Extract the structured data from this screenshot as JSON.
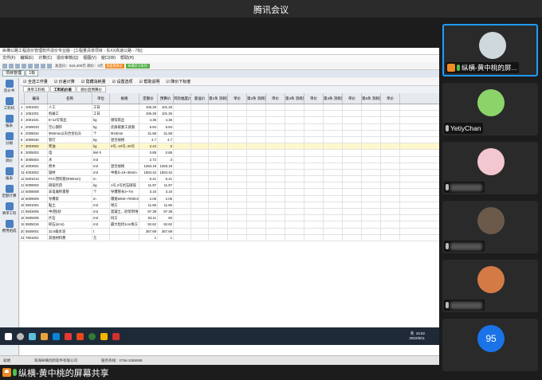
{
  "meeting": {
    "title": "腾讯会议",
    "share_label": "纵横-黄中桃的屏幕共享"
  },
  "app": {
    "title": "纵横公路工程造价管理软件造价专业版 - [工程量清单项目 - 东XX高速公路 - 7标]",
    "menus": [
      "文件(F)",
      "编辑(E)",
      "计算(C)",
      "造价审核(Q)",
      "视图(V)",
      "窗口(W)",
      "帮助(H)"
    ],
    "toolbar_info": "总造价：519,400元  调价：0元",
    "orange_btn": "我要提建议",
    "green_btn": "纵横学习系列",
    "module_tab": "项目管理",
    "doc_tab": "1标",
    "filters": [
      "全选工作量",
      "价差计算",
      "隐藏消耗量",
      "设置选项",
      "帮助说明",
      "降价下标度"
    ],
    "subtabs": [
      "清单工料机",
      "工料机价差",
      "调价后预算价"
    ],
    "active_subtab": 1,
    "left_nav": [
      "造价书",
      "工料机",
      "报表",
      "分摊",
      "调价",
      "报表",
      "定额计算",
      "清单工料",
      "费用组成"
    ],
    "columns": [
      "编号",
      "名称",
      "单位",
      "规格",
      "定额价",
      "预算价",
      "风险幅度(%)",
      "基准价"
    ],
    "phase_headers": [
      "第1条",
      "第2条",
      "第3条",
      "第4条",
      "第5条"
    ],
    "phase_sub": [
      "消耗量",
      "单价"
    ],
    "rows": [
      {
        "no": "1",
        "code": "1001001",
        "name": "人工",
        "unit": "工日",
        "spec": "",
        "p1": "106.28",
        "p2": "101.25"
      },
      {
        "no": "2",
        "code": "1051001",
        "name": "机械工",
        "unit": "工日",
        "spec": "",
        "p1": "106.28",
        "p2": "101.25"
      },
      {
        "no": "3",
        "code": "2001021",
        "name": "8~12号铁丝",
        "unit": "kg",
        "spec": "镀锌铁丝",
        "p1": "4.36",
        "p2": "4.36"
      },
      {
        "no": "4",
        "code": "2009033",
        "name": "空心钢钎",
        "unit": "kg",
        "spec": "优质碳素工具钢",
        "p1": "6.84",
        "p2": "6.84"
      },
      {
        "no": "5",
        "code": "2009034",
        "name": "Φ50mm以内合金钻头",
        "unit": "个",
        "spec": "Φ43mm",
        "p1": "31.68",
        "p2": "31.68"
      },
      {
        "no": "6",
        "code": "2009030",
        "name": "铁钉",
        "unit": "kg",
        "spec": "混合规格",
        "p1": "4.7",
        "p2": "4.7"
      },
      {
        "no": "7",
        "code": "3003002",
        "name": "柴油",
        "unit": "kg",
        "spec": "0号,-10号,-20号",
        "p1": "2.44",
        "p2": "0",
        "sel": true
      },
      {
        "no": "8",
        "code": "3005002",
        "name": "电",
        "unit": "kW·h",
        "spec": "",
        "p1": "0.85",
        "p2": "0.85"
      },
      {
        "no": "9",
        "code": "3005004",
        "name": "水",
        "unit": "m3",
        "spec": "",
        "p1": "2.72",
        "p2": "3"
      },
      {
        "no": "10",
        "code": "4003001",
        "name": "原木",
        "unit": "m3",
        "spec": "混合规格",
        "p1": "1283.19",
        "p2": "1283.19"
      },
      {
        "no": "11",
        "code": "4003002",
        "name": "锯材",
        "unit": "m3",
        "spec": "中板δ=19~35mm",
        "p1": "1504.42",
        "p2": "1504.42"
      },
      {
        "no": "12",
        "code": "5001013",
        "name": "PVC塑料管(Φ50mm)",
        "unit": "m",
        "spec": "",
        "p1": "6.41",
        "p2": "6.41"
      },
      {
        "no": "13",
        "code": "5009002",
        "name": "硝铵炸药",
        "unit": "kg",
        "spec": "1号,2号岩石硝铵",
        "p1": "11.97",
        "p2": "11.97"
      },
      {
        "no": "14",
        "code": "5009008",
        "name": "非电毫秒雷管",
        "unit": "个",
        "spec": "导爆管长3~7m",
        "p1": "3.16",
        "p2": "3.16"
      },
      {
        "no": "15",
        "code": "5009009",
        "name": "导爆索",
        "unit": "m",
        "spec": "爆速6000~7000m/s",
        "p1": "2.05",
        "p2": "2.05"
      },
      {
        "no": "16",
        "code": "5501001",
        "name": "黏土",
        "unit": "m3",
        "spec": "堆方",
        "p1": "11.65",
        "p2": "11.65"
      },
      {
        "no": "17",
        "code": "5503005",
        "name": "中(粗)砂",
        "unit": "m3",
        "spec": "混凝土、砂浆用堆",
        "p1": "87.38",
        "p2": "87.38"
      },
      {
        "no": "18",
        "code": "5505005",
        "name": "片石",
        "unit": "m3",
        "spec": "码方",
        "p1": "63.11",
        "p2": "60"
      },
      {
        "no": "19",
        "code": "5505016",
        "name": "碎石(4cm)",
        "unit": "m3",
        "spec": "最大粒径4cm堆方",
        "p1": "92.62",
        "p2": "92.62"
      },
      {
        "no": "20",
        "code": "5509001",
        "name": "32.5级水泥",
        "unit": "t",
        "spec": "",
        "p1": "367.69",
        "p2": "367.69"
      },
      {
        "no": "21",
        "code": "7801001",
        "name": "其他材料费",
        "unit": "元",
        "spec": "",
        "p1": "1",
        "p2": "1"
      }
    ],
    "status": [
      "就绪",
      "珠海纵横创新软件有限公司",
      "服务热线：0756-3388988"
    ]
  },
  "taskbar": {
    "lang": "英",
    "time": "16:52",
    "date": "2022/8/11"
  },
  "participants": [
    {
      "name": "纵横-黄中桃的屏...",
      "role": "host",
      "active": true,
      "avatar": "#cfd8dc"
    },
    {
      "name": "YetiyChan",
      "role": "guest",
      "active": false,
      "avatar": "#8bd46a"
    },
    {
      "name": "",
      "role": "guest",
      "active": false,
      "avatar": "#f3c7cf"
    },
    {
      "name": "",
      "role": "guest",
      "active": false,
      "avatar": "#6b5a4a"
    },
    {
      "name": "",
      "role": "guest",
      "active": false,
      "avatar": "#d47a45"
    },
    {
      "name": "95",
      "role": "guest",
      "active": false,
      "avatar": "#1a73e8"
    }
  ]
}
